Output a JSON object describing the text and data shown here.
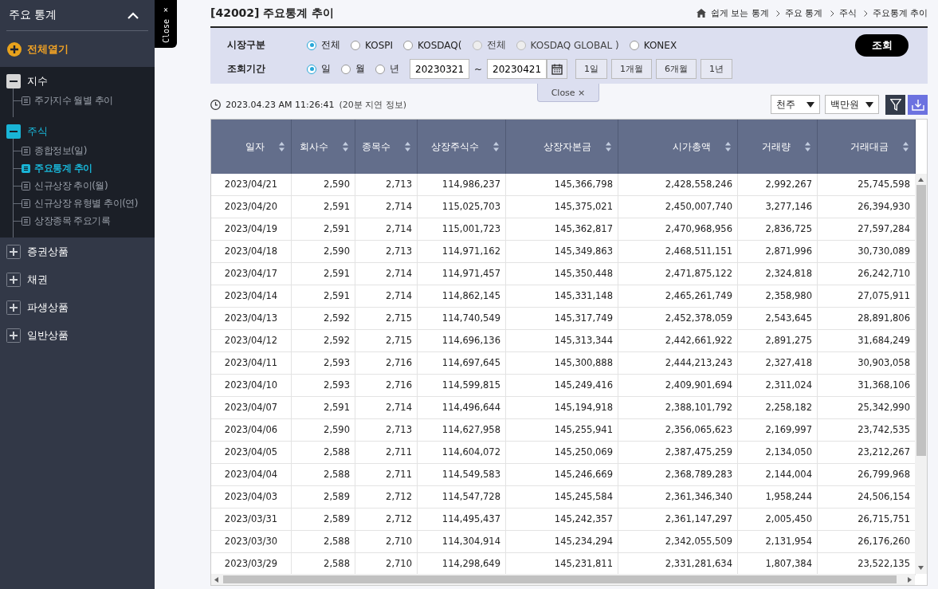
{
  "sidebar": {
    "title": "주요 통계",
    "expand_all": "전체열기",
    "groups": [
      {
        "label": "지수",
        "expanded": true,
        "active": false,
        "children": [
          {
            "label": "주가지수 월별 추이",
            "selected": false
          }
        ]
      },
      {
        "label": "주식",
        "expanded": true,
        "active": true,
        "children": [
          {
            "label": "종합정보(일)",
            "selected": false
          },
          {
            "label": "주요통계 추이",
            "selected": true
          },
          {
            "label": "신규상장 추이(월)",
            "selected": false
          },
          {
            "label": "신규상장 유형별 추이(연)",
            "selected": false
          },
          {
            "label": "상장종목 주요기록",
            "selected": false
          }
        ]
      },
      {
        "label": "증권상품",
        "expanded": false,
        "active": false
      },
      {
        "label": "채권",
        "expanded": false,
        "active": false
      },
      {
        "label": "파생상품",
        "expanded": false,
        "active": false
      },
      {
        "label": "일반상품",
        "expanded": false,
        "active": false
      }
    ]
  },
  "side_close_tab": "Close ×",
  "page_title": "[42002] 주요통계 추이",
  "breadcrumb": [
    "쉽게 보는 통계",
    "주요 통계",
    "주식",
    "주요통계 추이"
  ],
  "filters": {
    "market_label": "시장구분",
    "market_options": [
      {
        "label": "전체",
        "selected": true,
        "disabled": false
      },
      {
        "label": "KOSPI",
        "selected": false,
        "disabled": false
      },
      {
        "label": "KOSDAQ(",
        "selected": false,
        "disabled": false
      },
      {
        "label": "전체",
        "selected": false,
        "disabled": true
      },
      {
        "label": "KOSDAQ GLOBAL )",
        "selected": false,
        "disabled": true
      },
      {
        "label": "KONEX",
        "selected": false,
        "disabled": false
      }
    ],
    "period_label": "조회기간",
    "period_options": [
      {
        "label": "일",
        "selected": true
      },
      {
        "label": "월",
        "selected": false
      },
      {
        "label": "년",
        "selected": false
      }
    ],
    "date_from": "20230321",
    "date_sep": "~",
    "date_to": "20230421",
    "quick_buttons": [
      "1일",
      "1개월",
      "6개월",
      "1년"
    ],
    "search_button": "조회",
    "close_tab": "Close ×"
  },
  "timestamp": "2023.04.23 AM 11:26:41",
  "delay_note": "(20분 지연 정보)",
  "unit_selects": [
    "천주",
    "백만원"
  ],
  "table": {
    "columns": [
      "일자",
      "회사수",
      "종목수",
      "상장주식수",
      "상장자본금",
      "시가총액",
      "거래량",
      "거래대금"
    ],
    "rows": [
      [
        "2023/04/21",
        "2,590",
        "2,713",
        "114,986,237",
        "145,366,798",
        "2,428,558,246",
        "2,992,267",
        "25,745,598"
      ],
      [
        "2023/04/20",
        "2,591",
        "2,714",
        "115,025,703",
        "145,375,021",
        "2,450,007,740",
        "3,277,146",
        "26,394,930"
      ],
      [
        "2023/04/19",
        "2,591",
        "2,714",
        "115,001,723",
        "145,362,817",
        "2,470,968,956",
        "2,836,725",
        "27,597,284"
      ],
      [
        "2023/04/18",
        "2,590",
        "2,713",
        "114,971,162",
        "145,349,863",
        "2,468,511,151",
        "2,871,996",
        "30,730,089"
      ],
      [
        "2023/04/17",
        "2,591",
        "2,714",
        "114,971,457",
        "145,350,448",
        "2,471,875,122",
        "2,324,818",
        "26,242,710"
      ],
      [
        "2023/04/14",
        "2,591",
        "2,714",
        "114,862,145",
        "145,331,148",
        "2,465,261,749",
        "2,358,980",
        "27,075,911"
      ],
      [
        "2023/04/13",
        "2,592",
        "2,715",
        "114,740,549",
        "145,317,749",
        "2,452,378,059",
        "2,543,645",
        "28,891,806"
      ],
      [
        "2023/04/12",
        "2,592",
        "2,715",
        "114,696,136",
        "145,313,344",
        "2,442,661,922",
        "2,891,275",
        "31,684,249"
      ],
      [
        "2023/04/11",
        "2,593",
        "2,716",
        "114,697,645",
        "145,300,888",
        "2,444,213,243",
        "2,327,418",
        "30,903,058"
      ],
      [
        "2023/04/10",
        "2,593",
        "2,716",
        "114,599,815",
        "145,249,416",
        "2,409,901,694",
        "2,311,024",
        "31,368,106"
      ],
      [
        "2023/04/07",
        "2,591",
        "2,714",
        "114,496,644",
        "145,194,918",
        "2,388,101,792",
        "2,258,182",
        "25,342,990"
      ],
      [
        "2023/04/06",
        "2,590",
        "2,713",
        "114,627,958",
        "145,255,941",
        "2,356,065,623",
        "2,169,997",
        "23,742,535"
      ],
      [
        "2023/04/05",
        "2,588",
        "2,711",
        "114,604,072",
        "145,250,069",
        "2,387,475,259",
        "2,134,050",
        "23,212,267"
      ],
      [
        "2023/04/04",
        "2,588",
        "2,711",
        "114,549,583",
        "145,246,669",
        "2,368,789,283",
        "2,144,004",
        "26,799,968"
      ],
      [
        "2023/04/03",
        "2,589",
        "2,712",
        "114,547,728",
        "145,245,584",
        "2,361,346,340",
        "1,958,244",
        "24,506,154"
      ],
      [
        "2023/03/31",
        "2,589",
        "2,712",
        "114,495,437",
        "145,242,357",
        "2,361,147,297",
        "2,005,450",
        "26,715,751"
      ],
      [
        "2023/03/30",
        "2,588",
        "2,710",
        "114,304,914",
        "145,234,294",
        "2,342,055,509",
        "2,131,954",
        "26,176,260"
      ],
      [
        "2023/03/29",
        "2,588",
        "2,710",
        "114,298,649",
        "145,231,811",
        "2,331,281,634",
        "1,807,384",
        "23,522,135"
      ]
    ]
  }
}
